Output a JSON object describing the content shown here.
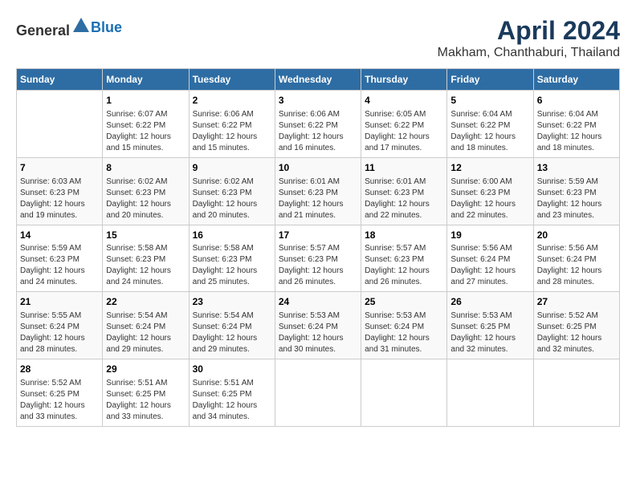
{
  "header": {
    "logo_general": "General",
    "logo_blue": "Blue",
    "title": "April 2024",
    "subtitle": "Makham, Chanthaburi, Thailand"
  },
  "weekdays": [
    "Sunday",
    "Monday",
    "Tuesday",
    "Wednesday",
    "Thursday",
    "Friday",
    "Saturday"
  ],
  "weeks": [
    [
      {
        "day": "",
        "info": ""
      },
      {
        "day": "1",
        "info": "Sunrise: 6:07 AM\nSunset: 6:22 PM\nDaylight: 12 hours\nand 15 minutes."
      },
      {
        "day": "2",
        "info": "Sunrise: 6:06 AM\nSunset: 6:22 PM\nDaylight: 12 hours\nand 15 minutes."
      },
      {
        "day": "3",
        "info": "Sunrise: 6:06 AM\nSunset: 6:22 PM\nDaylight: 12 hours\nand 16 minutes."
      },
      {
        "day": "4",
        "info": "Sunrise: 6:05 AM\nSunset: 6:22 PM\nDaylight: 12 hours\nand 17 minutes."
      },
      {
        "day": "5",
        "info": "Sunrise: 6:04 AM\nSunset: 6:22 PM\nDaylight: 12 hours\nand 18 minutes."
      },
      {
        "day": "6",
        "info": "Sunrise: 6:04 AM\nSunset: 6:22 PM\nDaylight: 12 hours\nand 18 minutes."
      }
    ],
    [
      {
        "day": "7",
        "info": "Sunrise: 6:03 AM\nSunset: 6:23 PM\nDaylight: 12 hours\nand 19 minutes."
      },
      {
        "day": "8",
        "info": "Sunrise: 6:02 AM\nSunset: 6:23 PM\nDaylight: 12 hours\nand 20 minutes."
      },
      {
        "day": "9",
        "info": "Sunrise: 6:02 AM\nSunset: 6:23 PM\nDaylight: 12 hours\nand 20 minutes."
      },
      {
        "day": "10",
        "info": "Sunrise: 6:01 AM\nSunset: 6:23 PM\nDaylight: 12 hours\nand 21 minutes."
      },
      {
        "day": "11",
        "info": "Sunrise: 6:01 AM\nSunset: 6:23 PM\nDaylight: 12 hours\nand 22 minutes."
      },
      {
        "day": "12",
        "info": "Sunrise: 6:00 AM\nSunset: 6:23 PM\nDaylight: 12 hours\nand 22 minutes."
      },
      {
        "day": "13",
        "info": "Sunrise: 5:59 AM\nSunset: 6:23 PM\nDaylight: 12 hours\nand 23 minutes."
      }
    ],
    [
      {
        "day": "14",
        "info": "Sunrise: 5:59 AM\nSunset: 6:23 PM\nDaylight: 12 hours\nand 24 minutes."
      },
      {
        "day": "15",
        "info": "Sunrise: 5:58 AM\nSunset: 6:23 PM\nDaylight: 12 hours\nand 24 minutes."
      },
      {
        "day": "16",
        "info": "Sunrise: 5:58 AM\nSunset: 6:23 PM\nDaylight: 12 hours\nand 25 minutes."
      },
      {
        "day": "17",
        "info": "Sunrise: 5:57 AM\nSunset: 6:23 PM\nDaylight: 12 hours\nand 26 minutes."
      },
      {
        "day": "18",
        "info": "Sunrise: 5:57 AM\nSunset: 6:23 PM\nDaylight: 12 hours\nand 26 minutes."
      },
      {
        "day": "19",
        "info": "Sunrise: 5:56 AM\nSunset: 6:24 PM\nDaylight: 12 hours\nand 27 minutes."
      },
      {
        "day": "20",
        "info": "Sunrise: 5:56 AM\nSunset: 6:24 PM\nDaylight: 12 hours\nand 28 minutes."
      }
    ],
    [
      {
        "day": "21",
        "info": "Sunrise: 5:55 AM\nSunset: 6:24 PM\nDaylight: 12 hours\nand 28 minutes."
      },
      {
        "day": "22",
        "info": "Sunrise: 5:54 AM\nSunset: 6:24 PM\nDaylight: 12 hours\nand 29 minutes."
      },
      {
        "day": "23",
        "info": "Sunrise: 5:54 AM\nSunset: 6:24 PM\nDaylight: 12 hours\nand 29 minutes."
      },
      {
        "day": "24",
        "info": "Sunrise: 5:53 AM\nSunset: 6:24 PM\nDaylight: 12 hours\nand 30 minutes."
      },
      {
        "day": "25",
        "info": "Sunrise: 5:53 AM\nSunset: 6:24 PM\nDaylight: 12 hours\nand 31 minutes."
      },
      {
        "day": "26",
        "info": "Sunrise: 5:53 AM\nSunset: 6:25 PM\nDaylight: 12 hours\nand 32 minutes."
      },
      {
        "day": "27",
        "info": "Sunrise: 5:52 AM\nSunset: 6:25 PM\nDaylight: 12 hours\nand 32 minutes."
      }
    ],
    [
      {
        "day": "28",
        "info": "Sunrise: 5:52 AM\nSunset: 6:25 PM\nDaylight: 12 hours\nand 33 minutes."
      },
      {
        "day": "29",
        "info": "Sunrise: 5:51 AM\nSunset: 6:25 PM\nDaylight: 12 hours\nand 33 minutes."
      },
      {
        "day": "30",
        "info": "Sunrise: 5:51 AM\nSunset: 6:25 PM\nDaylight: 12 hours\nand 34 minutes."
      },
      {
        "day": "",
        "info": ""
      },
      {
        "day": "",
        "info": ""
      },
      {
        "day": "",
        "info": ""
      },
      {
        "day": "",
        "info": ""
      }
    ]
  ]
}
